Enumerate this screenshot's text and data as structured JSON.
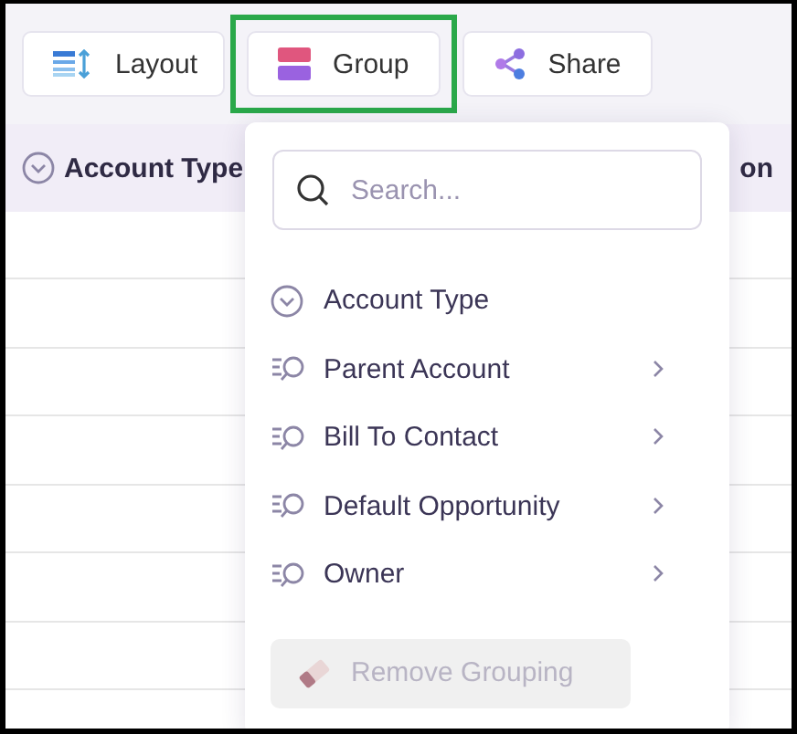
{
  "toolbar": {
    "buttons": [
      {
        "kind": "layout",
        "label": "Layout",
        "highlighted": false
      },
      {
        "kind": "group",
        "label": "Group",
        "highlighted": true
      },
      {
        "kind": "share",
        "label": "Share",
        "highlighted": false
      }
    ]
  },
  "table": {
    "columns": [
      {
        "kind": "picklist",
        "label": "Account Type"
      },
      {
        "kind": "plain",
        "label": "on"
      }
    ]
  },
  "group_menu": {
    "search": {
      "placeholder": "Search..."
    },
    "items": [
      {
        "kind": "picklist",
        "label": "Account Type",
        "has_submenu": false
      },
      {
        "kind": "lookup",
        "label": "Parent Account",
        "has_submenu": true
      },
      {
        "kind": "lookup",
        "label": "Bill To Contact",
        "has_submenu": true
      },
      {
        "kind": "lookup",
        "label": "Default Opportunity",
        "has_submenu": true
      },
      {
        "kind": "lookup",
        "label": "Owner",
        "has_submenu": true
      }
    ],
    "remove_button": {
      "label": "Remove Grouping",
      "disabled": true
    }
  }
}
